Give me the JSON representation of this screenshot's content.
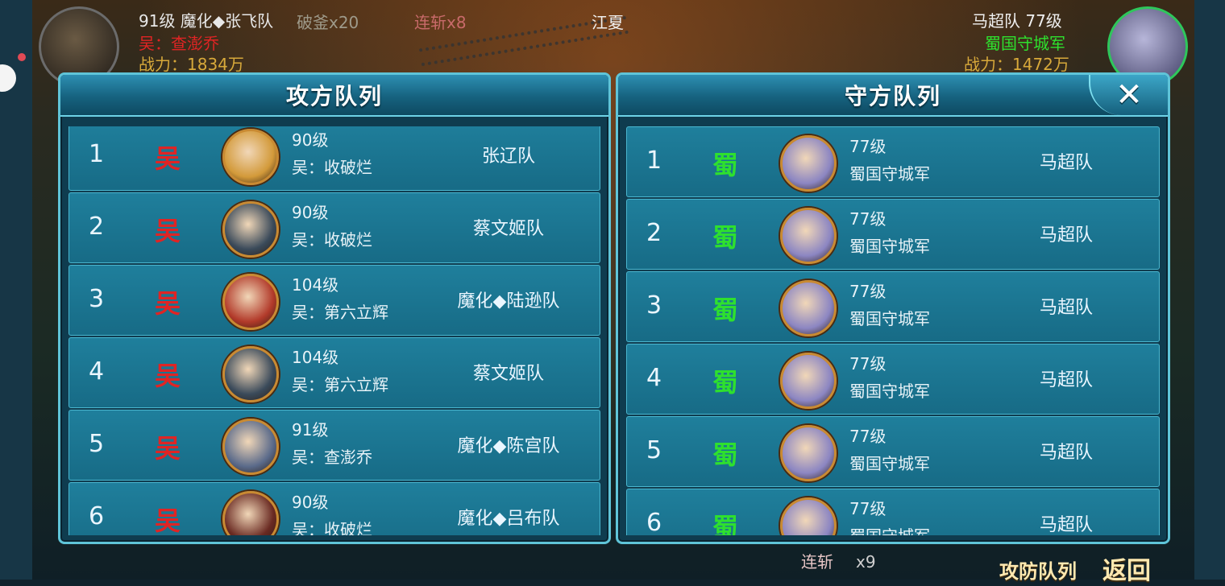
{
  "colors": {
    "wu": "#e02424",
    "shu": "#2ee02e",
    "accent": "#5fc4d8"
  },
  "top_bar": {
    "left": {
      "line1": "91级 魔化◆张飞队",
      "line2": "吴：查澎乔",
      "line3": "战力：1834万"
    },
    "center": {
      "buff1": "破釜x20",
      "buff2": "连斩x8",
      "location": "江夏"
    },
    "right": {
      "line1": "马超队 77级",
      "line2": "蜀国守城军",
      "line3": "战力：1472万"
    }
  },
  "attack_panel": {
    "title": "攻方队列",
    "rows": [
      {
        "idx": "1",
        "nation": "吴",
        "level": "90级",
        "guild": "吴：收破烂",
        "team": "张辽队",
        "portrait_icon": "hero-portrait-icon",
        "portrait_color": "#d39a3a"
      },
      {
        "idx": "2",
        "nation": "吴",
        "level": "90级",
        "guild": "吴：收破烂",
        "team": "蔡文姬队",
        "portrait_icon": "hero-portrait-icon",
        "portrait_color": "#3a4a5a"
      },
      {
        "idx": "3",
        "nation": "吴",
        "level": "104级",
        "guild": "吴：第六立辉",
        "team": "魔化◆陆逊队",
        "portrait_icon": "hero-portrait-icon",
        "portrait_color": "#b23a2a"
      },
      {
        "idx": "4",
        "nation": "吴",
        "level": "104级",
        "guild": "吴：第六立辉",
        "team": "蔡文姬队",
        "portrait_icon": "hero-portrait-icon",
        "portrait_color": "#3a4a5a"
      },
      {
        "idx": "5",
        "nation": "吴",
        "level": "91级",
        "guild": "吴：查澎乔",
        "team": "魔化◆陈宫队",
        "portrait_icon": "hero-portrait-icon",
        "portrait_color": "#5a6a8a"
      },
      {
        "idx": "6",
        "nation": "吴",
        "level": "90级",
        "guild": "吴：收破烂",
        "team": "魔化◆吕布队",
        "portrait_icon": "hero-portrait-icon",
        "portrait_color": "#6a2a22"
      }
    ]
  },
  "defense_panel": {
    "title": "守方队列",
    "close_label": "✕",
    "rows": [
      {
        "idx": "1",
        "nation": "蜀",
        "level": "77级",
        "guild": "蜀国守城军",
        "team": "马超队",
        "portrait_icon": "hero-portrait-icon",
        "portrait_color": "#8c86c2"
      },
      {
        "idx": "2",
        "nation": "蜀",
        "level": "77级",
        "guild": "蜀国守城军",
        "team": "马超队",
        "portrait_icon": "hero-portrait-icon",
        "portrait_color": "#8c86c2"
      },
      {
        "idx": "3",
        "nation": "蜀",
        "level": "77级",
        "guild": "蜀国守城军",
        "team": "马超队",
        "portrait_icon": "hero-portrait-icon",
        "portrait_color": "#8c86c2"
      },
      {
        "idx": "4",
        "nation": "蜀",
        "level": "77级",
        "guild": "蜀国守城军",
        "team": "马超队",
        "portrait_icon": "hero-portrait-icon",
        "portrait_color": "#8c86c2"
      },
      {
        "idx": "5",
        "nation": "蜀",
        "level": "77级",
        "guild": "蜀国守城军",
        "team": "马超队",
        "portrait_icon": "hero-portrait-icon",
        "portrait_color": "#8c86c2"
      },
      {
        "idx": "6",
        "nation": "蜀",
        "level": "77级",
        "guild": "蜀国守城军",
        "team": "马超队",
        "portrait_icon": "hero-portrait-icon",
        "portrait_color": "#8c86c2"
      }
    ]
  },
  "bottom_bar": {
    "combo_label": "连斩",
    "combo_count": "x9",
    "formation_button": "攻防队列",
    "back_button": "返回"
  }
}
